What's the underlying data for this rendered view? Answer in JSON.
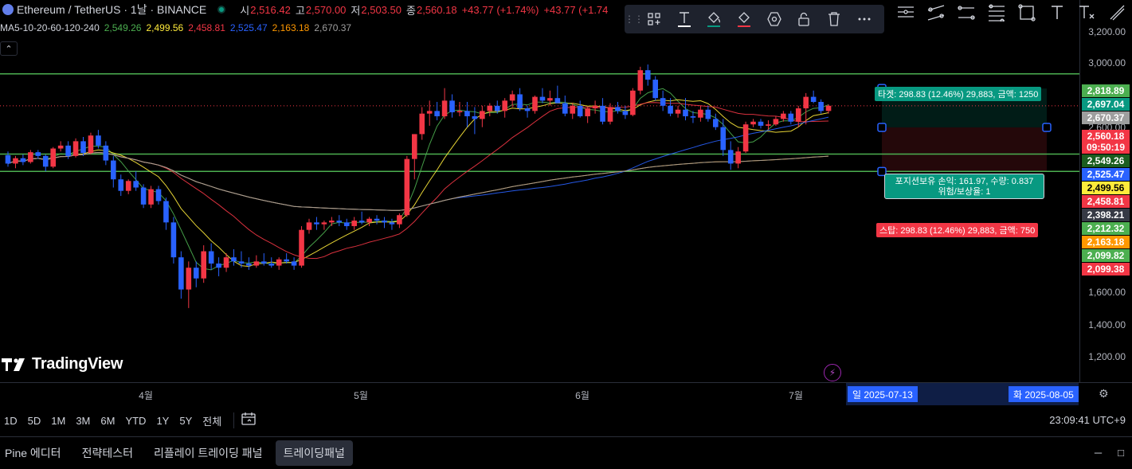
{
  "header": {
    "symbol": "Ethereum / TetherUS · 1날 · BINANCE",
    "ohlc": [
      {
        "label": "시",
        "value": "2,516.42"
      },
      {
        "label": "고",
        "value": "2,570.00"
      },
      {
        "label": "저",
        "value": "2,503.50"
      },
      {
        "label": "종",
        "value": "2,560.18"
      }
    ],
    "change": "+43.77 (+1.74%)",
    "change2": "+43.77 (+1.74",
    "ma_title": "MA5-10-20-60-120-240",
    "ma_values": [
      {
        "value": "2,549.26",
        "color": "#4caf50"
      },
      {
        "value": "2,499.56",
        "color": "#ffeb3b"
      },
      {
        "value": "2,458.81",
        "color": "#f23645"
      },
      {
        "value": "2,525.47",
        "color": "#2962ff"
      },
      {
        "value": "2,163.18",
        "color": "#ff9800"
      },
      {
        "value": "2,670.37",
        "color": "#9e9e9e"
      }
    ]
  },
  "drawing_toolbar": {
    "tools": [
      "layout-icon",
      "text-icon",
      "fill-icon",
      "line-color-icon",
      "settings-hex-icon",
      "lock-icon",
      "delete-icon",
      "more-icon"
    ]
  },
  "price_scale": {
    "ticks": [
      "3,200.00",
      "3,000.00",
      "2,600.00",
      "1,600.00",
      "1,400.00",
      "1,200.00"
    ],
    "labels": [
      {
        "text": "2,818.89",
        "bg": "#4caf50",
        "color": "#ffffff"
      },
      {
        "text": "2,697.04",
        "bg": "#089981",
        "color": "#ffffff"
      },
      {
        "text": "2,670.37",
        "bg": "#9e9e9e",
        "color": "#ffffff"
      },
      {
        "text": "2,560.18",
        "bg": "#f23645",
        "color": "#ffffff"
      },
      {
        "text": "09:50:19",
        "bg": "#f23645",
        "color": "#ffffff"
      },
      {
        "text": "2,549.26",
        "bg": "#1b5e20",
        "color": "#ffffff"
      },
      {
        "text": "2,525.47",
        "bg": "#2962ff",
        "color": "#ffffff"
      },
      {
        "text": "2,499.56",
        "bg": "#ffeb3b",
        "color": "#000000"
      },
      {
        "text": "2,458.81",
        "bg": "#f23645",
        "color": "#ffffff"
      },
      {
        "text": "2,398.21",
        "bg": "#363a45",
        "color": "#ffffff"
      },
      {
        "text": "2,212.32",
        "bg": "#4caf50",
        "color": "#ffffff"
      },
      {
        "text": "2,163.18",
        "bg": "#ff9800",
        "color": "#ffffff"
      },
      {
        "text": "2,099.82",
        "bg": "#4caf50",
        "color": "#ffffff"
      },
      {
        "text": "2,099.38",
        "bg": "#f23645",
        "color": "#ffffff"
      }
    ]
  },
  "position": {
    "target_label": "타겟: 298.83 (12.46%) 29,883, 금액: 1250",
    "mid_line1": "포지션보유 손익: 161.97, 수량: 0.837",
    "mid_line2": "위험/보상율: 1",
    "stop_label": "스탑: 298.83 (12.46%) 29,883, 금액: 750",
    "target_color": "#089981",
    "stop_color": "#f23645"
  },
  "brand": {
    "name": "TradingView"
  },
  "time_axis": {
    "months": [
      "4월",
      "5월",
      "6월",
      "7월"
    ],
    "range_start": "일 2025-07-13",
    "range_end": "화 2025-08-05"
  },
  "bottom_toolbar": {
    "periods": [
      "1D",
      "5D",
      "1M",
      "3M",
      "6M",
      "YTD",
      "1Y",
      "5Y",
      "전체"
    ],
    "clock": "23:09:41 UTC+9"
  },
  "panel_tabs": [
    {
      "label": "Pine 에디터",
      "active": false
    },
    {
      "label": "전략테스터",
      "active": false
    },
    {
      "label": "리플레이 트레이딩 패널",
      "active": false
    },
    {
      "label": "트레이딩패널",
      "active": true
    }
  ],
  "chart_data": {
    "type": "candlestick",
    "symbol": "ETH/USDT",
    "interval": "1D",
    "ylim": [
      1120,
      3300
    ],
    "log_scale": true,
    "price_lines": [
      2818.89,
      2212.32,
      2099.82
    ],
    "position_zone": {
      "entry": 2398.21,
      "target": 2697.04,
      "stop": 2099.38
    },
    "candles": [
      [
        2205,
        2230,
        2130,
        2150
      ],
      [
        2150,
        2200,
        2120,
        2185
      ],
      [
        2185,
        2210,
        2140,
        2160
      ],
      [
        2160,
        2240,
        2150,
        2225
      ],
      [
        2225,
        2240,
        2180,
        2200
      ],
      [
        2200,
        2210,
        2100,
        2130
      ],
      [
        2130,
        2260,
        2120,
        2250
      ],
      [
        2250,
        2300,
        2230,
        2270
      ],
      [
        2270,
        2300,
        2180,
        2200
      ],
      [
        2200,
        2320,
        2190,
        2300
      ],
      [
        2300,
        2330,
        2200,
        2220
      ],
      [
        2220,
        2360,
        2210,
        2340
      ],
      [
        2340,
        2380,
        2250,
        2270
      ],
      [
        2270,
        2300,
        2140,
        2170
      ],
      [
        2170,
        2200,
        2000,
        2050
      ],
      [
        2050,
        2080,
        1950,
        1980
      ],
      [
        1980,
        2050,
        1960,
        2040
      ],
      [
        2040,
        2100,
        1980,
        2000
      ],
      [
        2000,
        2020,
        1880,
        1900
      ],
      [
        1900,
        2010,
        1880,
        1990
      ],
      [
        1990,
        2010,
        1900,
        1920
      ],
      [
        1920,
        1940,
        1760,
        1800
      ],
      [
        1800,
        1830,
        1590,
        1620
      ],
      [
        1620,
        1650,
        1430,
        1470
      ],
      [
        1470,
        1600,
        1390,
        1570
      ],
      [
        1570,
        1600,
        1480,
        1520
      ],
      [
        1520,
        1680,
        1500,
        1650
      ],
      [
        1650,
        1690,
        1560,
        1590
      ],
      [
        1590,
        1620,
        1530,
        1570
      ],
      [
        1570,
        1640,
        1550,
        1620
      ],
      [
        1620,
        1660,
        1580,
        1600
      ],
      [
        1600,
        1650,
        1570,
        1590
      ],
      [
        1590,
        1620,
        1560,
        1580
      ],
      [
        1580,
        1630,
        1570,
        1600
      ],
      [
        1600,
        1640,
        1580,
        1590
      ],
      [
        1590,
        1620,
        1570,
        1580
      ],
      [
        1580,
        1620,
        1560,
        1610
      ],
      [
        1610,
        1640,
        1590,
        1600
      ],
      [
        1600,
        1620,
        1560,
        1580
      ],
      [
        1580,
        1780,
        1570,
        1760
      ],
      [
        1760,
        1820,
        1740,
        1800
      ],
      [
        1800,
        1830,
        1760,
        1790
      ],
      [
        1790,
        1810,
        1760,
        1800
      ],
      [
        1800,
        1830,
        1780,
        1810
      ],
      [
        1810,
        1840,
        1780,
        1800
      ],
      [
        1800,
        1820,
        1760,
        1780
      ],
      [
        1780,
        1830,
        1760,
        1810
      ],
      [
        1810,
        1860,
        1790,
        1800
      ],
      [
        1800,
        1830,
        1780,
        1820
      ],
      [
        1820,
        1840,
        1790,
        1810
      ],
      [
        1810,
        1830,
        1770,
        1800
      ],
      [
        1800,
        1820,
        1760,
        1790
      ],
      [
        1790,
        1850,
        1770,
        1840
      ],
      [
        1840,
        2200,
        1830,
        2180
      ],
      [
        2180,
        2350,
        2050,
        2350
      ],
      [
        2350,
        2550,
        2310,
        2500
      ],
      [
        2500,
        2600,
        2410,
        2520
      ],
      [
        2520,
        2590,
        2450,
        2480
      ],
      [
        2480,
        2700,
        2460,
        2600
      ],
      [
        2600,
        2650,
        2470,
        2510
      ],
      [
        2510,
        2590,
        2480,
        2520
      ],
      [
        2520,
        2590,
        2400,
        2480
      ],
      [
        2480,
        2550,
        2350,
        2460
      ],
      [
        2460,
        2560,
        2400,
        2520
      ],
      [
        2520,
        2580,
        2480,
        2560
      ],
      [
        2560,
        2600,
        2500,
        2520
      ],
      [
        2520,
        2620,
        2470,
        2600
      ],
      [
        2600,
        2680,
        2550,
        2650
      ],
      [
        2650,
        2700,
        2520,
        2540
      ],
      [
        2540,
        2560,
        2470,
        2520
      ],
      [
        2520,
        2640,
        2500,
        2630
      ],
      [
        2630,
        2700,
        2580,
        2600
      ],
      [
        2600,
        2680,
        2560,
        2620
      ],
      [
        2620,
        2720,
        2580,
        2580
      ],
      [
        2580,
        2640,
        2480,
        2500
      ],
      [
        2500,
        2580,
        2460,
        2560
      ],
      [
        2560,
        2600,
        2470,
        2480
      ],
      [
        2480,
        2550,
        2430,
        2540
      ],
      [
        2540,
        2600,
        2500,
        2560
      ],
      [
        2560,
        2620,
        2420,
        2440
      ],
      [
        2440,
        2580,
        2420,
        2550
      ],
      [
        2550,
        2590,
        2500,
        2520
      ],
      [
        2520,
        2560,
        2460,
        2490
      ],
      [
        2490,
        2700,
        2480,
        2680
      ],
      [
        2680,
        2880,
        2650,
        2850
      ],
      [
        2850,
        2900,
        2720,
        2770
      ],
      [
        2770,
        2800,
        2600,
        2620
      ],
      [
        2620,
        2680,
        2520,
        2560
      ],
      [
        2560,
        2620,
        2480,
        2500
      ],
      [
        2500,
        2560,
        2470,
        2530
      ],
      [
        2530,
        2620,
        2450,
        2480
      ],
      [
        2480,
        2520,
        2430,
        2470
      ],
      [
        2470,
        2560,
        2440,
        2530
      ],
      [
        2530,
        2560,
        2440,
        2460
      ],
      [
        2460,
        2500,
        2380,
        2400
      ],
      [
        2400,
        2460,
        2200,
        2240
      ],
      [
        2240,
        2300,
        2110,
        2150
      ],
      [
        2150,
        2260,
        2120,
        2230
      ],
      [
        2230,
        2440,
        2220,
        2420
      ],
      [
        2420,
        2460,
        2400,
        2440
      ],
      [
        2440,
        2460,
        2390,
        2410
      ],
      [
        2410,
        2450,
        2380,
        2420
      ],
      [
        2420,
        2480,
        2410,
        2460
      ],
      [
        2460,
        2520,
        2440,
        2500
      ],
      [
        2500,
        2520,
        2420,
        2440
      ],
      [
        2440,
        2560,
        2400,
        2540
      ],
      [
        2540,
        2660,
        2420,
        2630
      ],
      [
        2630,
        2680,
        2580,
        2590
      ],
      [
        2590,
        2610,
        2500,
        2520
      ],
      [
        2520,
        2570,
        2500,
        2560
      ]
    ],
    "ma_lines": [
      {
        "name": "MA5",
        "color": "#4caf50"
      },
      {
        "name": "MA10",
        "color": "#ffeb3b"
      },
      {
        "name": "MA20",
        "color": "#f23645"
      },
      {
        "name": "MA60",
        "color": "#2962ff"
      },
      {
        "name": "MA120",
        "color": "#ff9800"
      },
      {
        "name": "MA240",
        "color": "#9e9e9e"
      }
    ],
    "up_color": "#f23645",
    "down_color": "#2962ff"
  }
}
